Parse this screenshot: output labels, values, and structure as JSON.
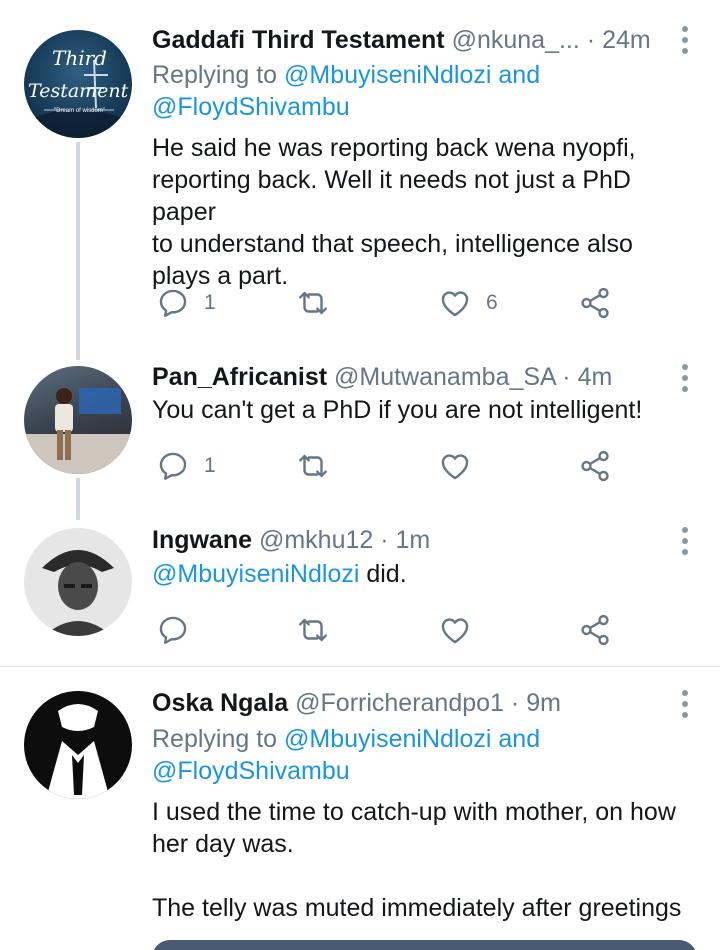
{
  "tweets": [
    {
      "name": "Gaddafi Third Testament",
      "handle": "@nkuna_...",
      "time": "· 24m",
      "reply_prefix": "Replying to",
      "reply_mention1": "@MbuyiseniNdlozi",
      "reply_and": "and",
      "reply_mention2": "@FloydShivambu",
      "text_lines": [
        "He said he was reporting back wena nyopfi,",
        "reporting back. Well it needs not just a PhD paper",
        "to understand that speech, intelligence also",
        "plays a part."
      ],
      "replies": "1",
      "likes": "6",
      "avatar_line1": "Third",
      "avatar_line2": "Testament",
      "avatar_tagline": "\"Dream of wisdom\""
    },
    {
      "name": "Pan_Africanist",
      "handle": "@Mutwanamba_SA",
      "time": "· 4m",
      "text": "You can't get a PhD if you are not intelligent!",
      "replies": "1"
    },
    {
      "name": "Ingwane",
      "handle": "@mkhu12",
      "time": "· 1m",
      "mention": "@MbuyiseniNdlozi",
      "text_rest": " did."
    },
    {
      "name": "Oska Ngala",
      "handle": "@Forricherandpo1",
      "time": "· 9m",
      "reply_prefix": "Replying to",
      "reply_mention1": "@MbuyiseniNdlozi",
      "reply_and": "and",
      "reply_mention2": "@FloydShivambu",
      "text_lines": [
        "I used the time to catch-up with mother, on how",
        "her day was.",
        "",
        "The telly was muted immediately after greetings"
      ]
    }
  ],
  "colors": {
    "link": "#1b95e0",
    "meta": "#657786",
    "thread_line": "#cfd9de",
    "icon": "#657786"
  },
  "icons": [
    "reply-icon",
    "retweet-icon",
    "like-icon",
    "share-icon",
    "more-options-icon"
  ]
}
